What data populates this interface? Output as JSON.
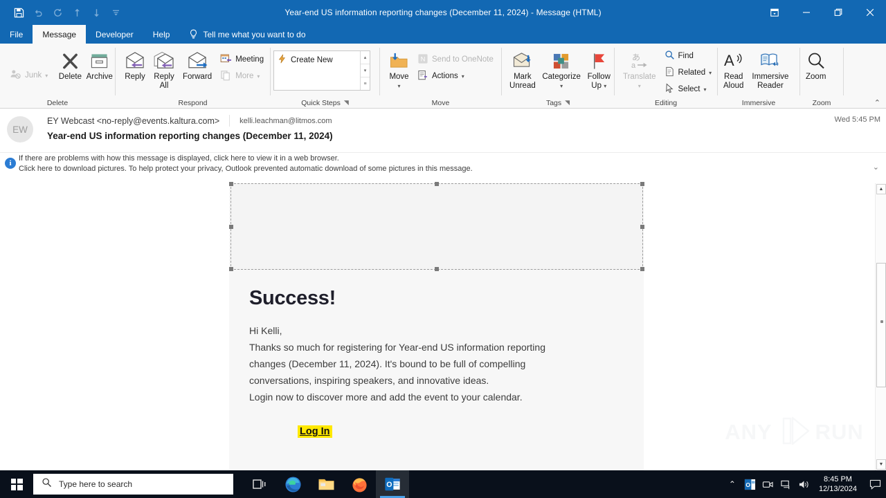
{
  "window": {
    "title": "Year-end US information reporting changes (December 11, 2024)  -  Message (HTML)",
    "accent_color": "#1268b3",
    "quick_access": [
      {
        "name": "save",
        "label": "Save"
      },
      {
        "name": "undo",
        "label": "Undo"
      },
      {
        "name": "redo",
        "label": "Redo"
      },
      {
        "name": "previous-item",
        "label": "Previous Item"
      },
      {
        "name": "next-item",
        "label": "Next Item"
      },
      {
        "name": "customize-quick-access-toolbar",
        "label": "Customize Quick Access Toolbar"
      }
    ],
    "controls": {
      "ribbon_display": "Ribbon Display Options",
      "minimize": "Minimize",
      "restore": "Restore Down",
      "close": "Close"
    }
  },
  "tabs": [
    {
      "label": "File",
      "active": false
    },
    {
      "label": "Message",
      "active": true
    },
    {
      "label": "Developer",
      "active": false
    },
    {
      "label": "Help",
      "active": false
    }
  ],
  "tell_me": {
    "label": "Tell me what you want to do",
    "icon": "lightbulb-icon"
  },
  "ribbon": {
    "collapse_label": "Collapse the Ribbon",
    "groups": [
      {
        "name": "delete",
        "label": "Delete",
        "has_launcher": false,
        "buttons": [
          {
            "name": "junk",
            "label": "Junk",
            "type": "small",
            "disabled": true,
            "dropdown": true
          },
          {
            "name": "delete",
            "label": "Delete",
            "type": "big",
            "disabled": false
          },
          {
            "name": "archive",
            "label": "Archive",
            "type": "big",
            "disabled": false
          }
        ]
      },
      {
        "name": "respond",
        "label": "Respond",
        "has_launcher": false,
        "buttons": [
          {
            "name": "reply",
            "label": "Reply",
            "label2": "",
            "type": "big",
            "disabled": false
          },
          {
            "name": "reply-all",
            "label": "Reply",
            "label2": "All",
            "type": "big",
            "disabled": false
          },
          {
            "name": "forward",
            "label": "Forward",
            "label2": "",
            "type": "big",
            "disabled": false
          },
          {
            "name": "meeting",
            "label": "Meeting",
            "type": "small",
            "disabled": false,
            "dropdown": false
          },
          {
            "name": "more",
            "label": "More",
            "type": "small",
            "disabled": true,
            "dropdown": true
          }
        ]
      },
      {
        "name": "quick-steps",
        "label": "Quick Steps",
        "has_launcher": true,
        "gallery_item": "Create New"
      },
      {
        "name": "move",
        "label": "Move",
        "has_launcher": false,
        "buttons": [
          {
            "name": "move",
            "label": "Move",
            "type": "big",
            "disabled": false,
            "dropdown": true
          },
          {
            "name": "send-to-onenote",
            "label": "Send to OneNote",
            "type": "small",
            "disabled": true,
            "dropdown": false
          },
          {
            "name": "actions",
            "label": "Actions",
            "type": "small",
            "disabled": false,
            "dropdown": true
          }
        ]
      },
      {
        "name": "tags",
        "label": "Tags",
        "has_launcher": true,
        "buttons": [
          {
            "name": "mark-unread",
            "label": "Mark",
            "label2": "Unread",
            "type": "big",
            "disabled": false
          },
          {
            "name": "categorize",
            "label": "Categorize",
            "label2": "",
            "type": "big",
            "disabled": false,
            "dropdown": true
          },
          {
            "name": "follow-up",
            "label": "Follow",
            "label2": "Up",
            "type": "big",
            "disabled": false,
            "dropdown": true
          }
        ]
      },
      {
        "name": "editing",
        "label": "Editing",
        "has_launcher": false,
        "buttons": [
          {
            "name": "translate",
            "label": "Translate",
            "type": "big",
            "disabled": true,
            "dropdown": true
          },
          {
            "name": "find",
            "label": "Find",
            "type": "small",
            "disabled": false,
            "dropdown": false
          },
          {
            "name": "related",
            "label": "Related",
            "type": "small",
            "disabled": false,
            "dropdown": true
          },
          {
            "name": "select",
            "label": "Select",
            "type": "small",
            "disabled": false,
            "dropdown": true
          }
        ]
      },
      {
        "name": "immersive",
        "label": "Immersive",
        "has_launcher": false,
        "buttons": [
          {
            "name": "read-aloud",
            "label": "Read",
            "label2": "Aloud",
            "type": "big",
            "disabled": false
          },
          {
            "name": "immersive-reader",
            "label": "Immersive",
            "label2": "Reader",
            "type": "big",
            "disabled": false
          }
        ]
      },
      {
        "name": "zoom",
        "label": "Zoom",
        "has_launcher": false,
        "buttons": [
          {
            "name": "zoom",
            "label": "Zoom",
            "label2": "",
            "type": "big",
            "disabled": false
          }
        ]
      }
    ]
  },
  "message": {
    "avatar_initials": "EW",
    "sender": "EY Webcast <no-reply@events.kaltura.com>",
    "recipient": "kelli.leachman@litmos.com",
    "received": "Wed 5:45 PM",
    "subject": "Year-end US information reporting changes (December 11, 2024)",
    "info_bar": {
      "line1": "If there are problems with how this message is displayed, click here to view it in a web browser.",
      "line2": "Click here to download pictures. To help protect your privacy, Outlook prevented automatic download of some pictures in this message.",
      "expand_icon": "chevron-down-icon"
    }
  },
  "mail_body": {
    "blocked_image_alt": "",
    "heading": "Success!",
    "greeting": "Hi Kelli,",
    "paragraph_line1": "Thanks so much for registering for Year-end US information reporting",
    "paragraph_line2": "changes (December 11, 2024). It's bound to be full of compelling",
    "paragraph_line3": "conversations, inspiring speakers, and innovative ideas.",
    "paragraph_line4": "Login now to discover more and add the event to your calendar.",
    "cta_label": "Log In",
    "cta_highlight_color": "#ffe800",
    "background_color": "#f7f7f7"
  },
  "watermark": {
    "left_text": "ANY",
    "right_text": "RUN"
  },
  "scrollbar": {
    "up_label": "Scroll up",
    "down_label": "Scroll down",
    "thumb_label": "Vertical scroll thumb"
  },
  "taskbar": {
    "start_label": "Start",
    "search_placeholder": "Type here to search",
    "items": [
      {
        "name": "task-view",
        "label": "Task View"
      },
      {
        "name": "microsoft-edge",
        "label": "Microsoft Edge"
      },
      {
        "name": "file-explorer",
        "label": "File Explorer"
      },
      {
        "name": "firefox",
        "label": "Mozilla Firefox"
      },
      {
        "name": "outlook",
        "label": "Microsoft Outlook",
        "active": true
      }
    ],
    "tray": [
      {
        "name": "show-hidden-icons",
        "label": "Show hidden icons"
      },
      {
        "name": "outlook-tray",
        "label": "Outlook"
      },
      {
        "name": "camera-tray",
        "label": "Camera"
      },
      {
        "name": "network-tray",
        "label": "Network"
      },
      {
        "name": "volume-tray",
        "label": "Volume"
      }
    ],
    "clock_time": "8:45 PM",
    "clock_date": "12/13/2024",
    "action_center": "Action Center"
  }
}
